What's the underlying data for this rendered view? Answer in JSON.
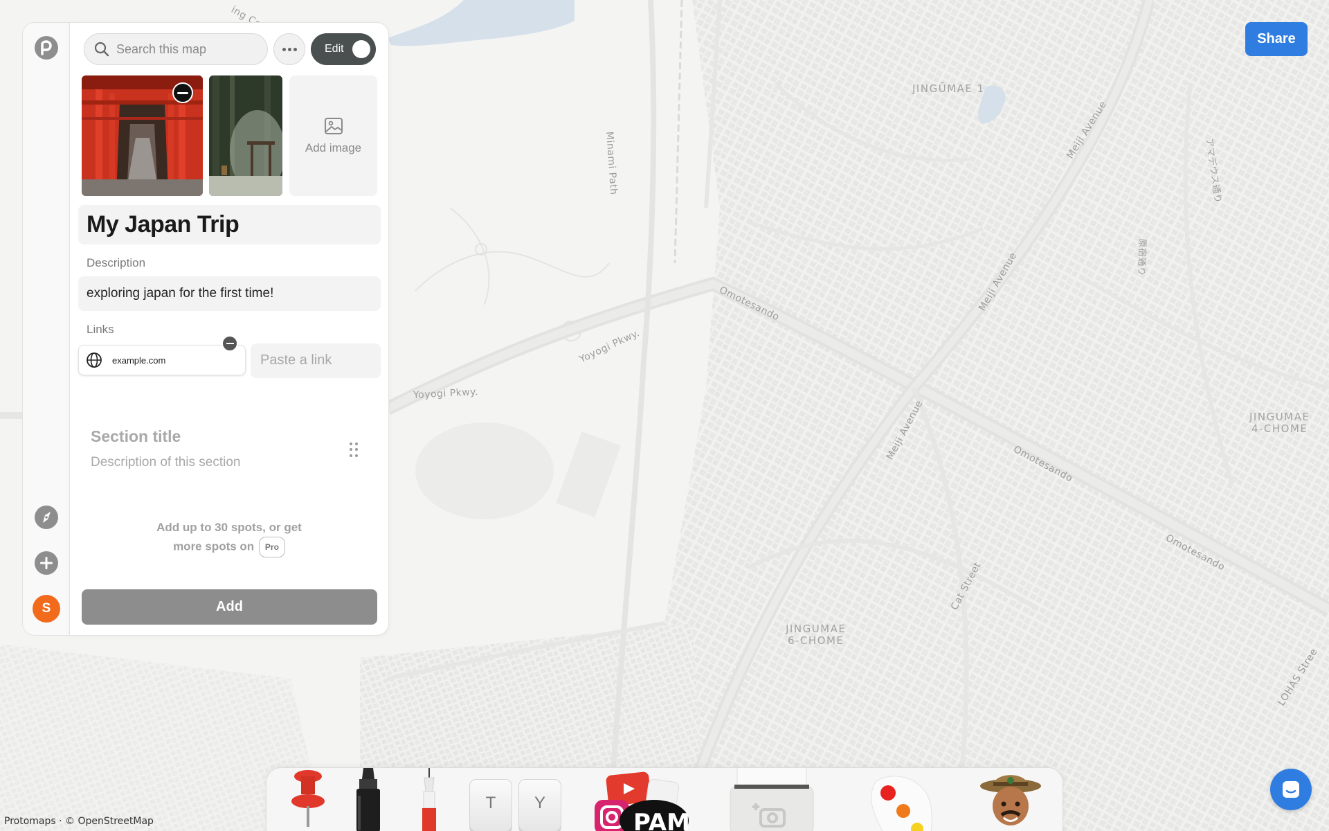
{
  "map": {
    "labels": {
      "ring_co": "ing Co",
      "minami_path": "Minami Path",
      "jingumae1": "JINGŪMAE 1",
      "meiji_avenue_1": "Meiji Avenue",
      "meiji_avenue_2": "Meiji Avenue",
      "meiji_avenue_3": "Meiji Avenue",
      "omotesando_1": "Omotesando",
      "omotesando_2": "Omotesando",
      "omotesando_3": "Omotesando",
      "yoyogi_pkwy_1": "Yoyogi Pkwy.",
      "yoyogi_pkwy_2": "Yoyogi Pkwy.",
      "jingumae4_line1": "JINGUMAE",
      "jingumae4_line2": "4-CHOME",
      "jingumae6_line1": "JINGUMAE",
      "jingumae6_line2": "6-CHOME",
      "cat_street": "Cat Street",
      "lohas_street": "LOHAS Stree",
      "jp_1": "アマデウス通り",
      "jp_2": "原宿通り"
    },
    "attribution": "Protomaps · © OpenStreetMap"
  },
  "rail": {
    "logo": "protomaps-logo-icon",
    "explore": "compass-icon",
    "add": "plus-icon",
    "avatar_initial": "S"
  },
  "panel": {
    "search_placeholder": "Search this map",
    "edit_label": "Edit",
    "add_image_label": "Add image",
    "title": "My Japan Trip",
    "description_label": "Description",
    "description": "exploring japan for the first time!",
    "links_label": "Links",
    "link_text": "example.com",
    "paste_link_placeholder": "Paste a link",
    "section_title_placeholder": "Section title",
    "section_desc_placeholder": "Description of this section",
    "spots_note_line1": "Add up to 30 spots, or get",
    "spots_note_line2": "more spots on",
    "pro_badge": "Pro",
    "add_button": "Add"
  },
  "share_button": "Share",
  "dock": {
    "key_t": "T",
    "key_y": "Y",
    "pam_label": "PAM"
  },
  "colors": {
    "accent": "#2f7de1",
    "toggle": "#4a4f4f",
    "avatar": "#f26b1d",
    "add_button": "#8d8d8d"
  }
}
